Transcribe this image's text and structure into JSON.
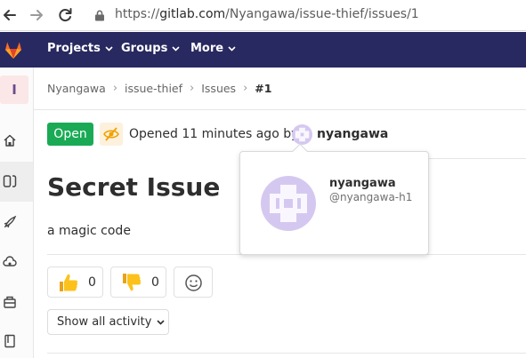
{
  "browser": {
    "url_scheme": "https://",
    "url_host": "gitlab.com",
    "url_path": "/Nyangawa/issue-thief/issues/1"
  },
  "topnav": {
    "items": [
      {
        "label": "Projects"
      },
      {
        "label": "Groups"
      },
      {
        "label": "More"
      }
    ]
  },
  "sidebar": {
    "project_initial": "I",
    "items": [
      "home-icon",
      "issues-icon",
      "rocket-icon",
      "cloud-icon",
      "package-icon",
      "wiki-icon"
    ]
  },
  "breadcrumb": {
    "items": [
      "Nyangawa",
      "issue-thief",
      "Issues"
    ],
    "current": "#1"
  },
  "issue": {
    "status": "Open",
    "status_color": "#1aaa55",
    "confidential_icon": "eye-slash-icon",
    "opened_text": "Opened 11 minutes ago by",
    "author": "nyangawa",
    "title": "Secret Issue",
    "description": "a magic code"
  },
  "popover": {
    "name": "nyangawa",
    "handle": "@nyangawa-h1"
  },
  "awards": {
    "thumbsup_count": "0",
    "thumbsdown_count": "0"
  },
  "activity": {
    "filter_label": "Show all activity"
  },
  "colors": {
    "header": "#292961",
    "accent_orange": "#fc6d26",
    "avatar": "#d5c8f0"
  }
}
